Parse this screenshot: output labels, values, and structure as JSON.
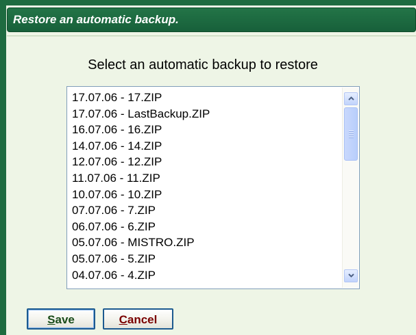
{
  "dialog": {
    "title": "Restore an automatic backup.",
    "heading": "Select an automatic backup to restore"
  },
  "backup_list": {
    "items": [
      "17.07.06 - 17.ZIP",
      "17.07.06 - LastBackup.ZIP",
      "16.07.06 - 16.ZIP",
      "14.07.06 - 14.ZIP",
      "12.07.06 - 12.ZIP",
      "11.07.06 - 11.ZIP",
      "10.07.06 - 10.ZIP",
      "07.07.06 - 7.ZIP",
      "06.07.06 - 6.ZIP",
      "05.07.06 - MISTRO.ZIP",
      "05.07.06 - 5.ZIP",
      "04.07.06 - 4.ZIP"
    ]
  },
  "buttons": {
    "save_label": "Save",
    "cancel_label": "Cancel"
  },
  "icons": {
    "scroll_up": "chevron-up-icon",
    "scroll_down": "chevron-down-icon"
  },
  "colors": {
    "title_bar": "#1e6b40",
    "background": "#eef5e6",
    "button_border": "#1c5a8f",
    "save_text": "#1a4c1a",
    "cancel_text": "#7a0000"
  }
}
